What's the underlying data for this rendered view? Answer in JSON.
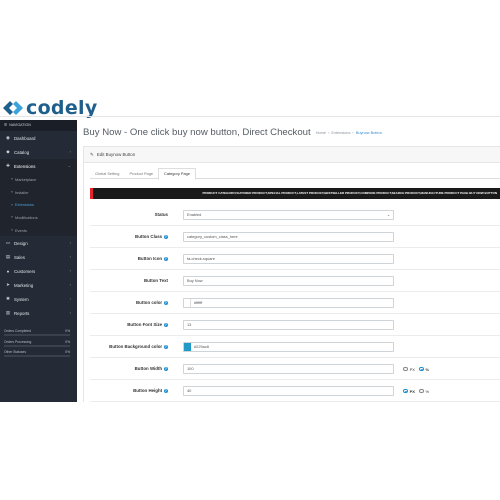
{
  "brand": {
    "name": "codely",
    "logo_icon": "codely-logo-icon"
  },
  "sidebar": {
    "nav_header": "NAVIGATION",
    "items": [
      {
        "label": "Dashboard",
        "icon": "dashboard-icon",
        "glyph": "◉"
      },
      {
        "label": "Catalog",
        "icon": "tag-icon",
        "glyph": "◆"
      },
      {
        "label": "Extensions",
        "icon": "puzzle-icon",
        "glyph": "✚"
      }
    ],
    "sub_items": [
      {
        "label": "Marketplace"
      },
      {
        "label": "Installer"
      },
      {
        "label": "Extensions"
      },
      {
        "label": "Modifications"
      },
      {
        "label": "Events"
      }
    ],
    "lower_items": [
      {
        "label": "Design",
        "icon": "monitor-icon",
        "glyph": "▭"
      },
      {
        "label": "Sales",
        "icon": "cart-icon",
        "glyph": "▤"
      },
      {
        "label": "Customers",
        "icon": "user-icon",
        "glyph": "●"
      },
      {
        "label": "Marketing",
        "icon": "share-icon",
        "glyph": "➤"
      },
      {
        "label": "System",
        "icon": "gear-icon",
        "glyph": "✱"
      },
      {
        "label": "Reports",
        "icon": "chart-icon",
        "glyph": "▥"
      }
    ],
    "stats": [
      {
        "label": "Orders Completed",
        "value": "0%",
        "progress": 0
      },
      {
        "label": "Orders Processing",
        "value": "0%",
        "progress": 0
      },
      {
        "label": "Other Statuses",
        "value": "0%",
        "progress": 0
      }
    ]
  },
  "page": {
    "title": "Buy Now - One click buy now button, Direct Checkout",
    "breadcrumb": [
      "Home",
      "Extensions",
      "Buynow Button"
    ]
  },
  "panel": {
    "heading": "Edit Buynow Button",
    "tabs": [
      "Global Setting",
      "Product Page",
      "Category Page"
    ],
    "active_tab": "Category Page",
    "banner": "PRODUCT CATEGORY,FEATURED PRODUCT,SPECIAL PRODUCT,LATEST PRODUCT,BESTSELLER PRODUCT,COMPARE PRODUCT,SEARCH PRODUCT,MANUFACTURE PRODUCT PAGE BUY NOW BUTTON"
  },
  "form": {
    "status": {
      "label": "Status",
      "value": "Enabled"
    },
    "button_class": {
      "label": "Button Class",
      "value": "category_custom_class_here"
    },
    "button_icon": {
      "label": "Button Icon",
      "value": "fa-check-square"
    },
    "button_text": {
      "label": "Button Text",
      "value": "Buy Now"
    },
    "button_color": {
      "label": "Button color",
      "value": "#ffffff",
      "swatch": "#ffffff"
    },
    "button_font_size": {
      "label": "Button Font Size",
      "value": "13"
    },
    "button_bg_color": {
      "label": "Button Background color",
      "value": "#229ac8",
      "swatch": "#229ac8"
    },
    "button_width": {
      "label": "Button Width",
      "value": "100",
      "unit_px": "PX",
      "unit_pct": "%",
      "selected": "%"
    },
    "button_height": {
      "label": "Button Height",
      "value": "40",
      "unit_px": "PX",
      "unit_pct": "%",
      "selected": "PX"
    }
  },
  "colors": {
    "sidebar_bg": "#252b36",
    "accent": "#1e91cf",
    "banner_bg": "#1a1a1a",
    "banner_accent": "#e3262e"
  }
}
